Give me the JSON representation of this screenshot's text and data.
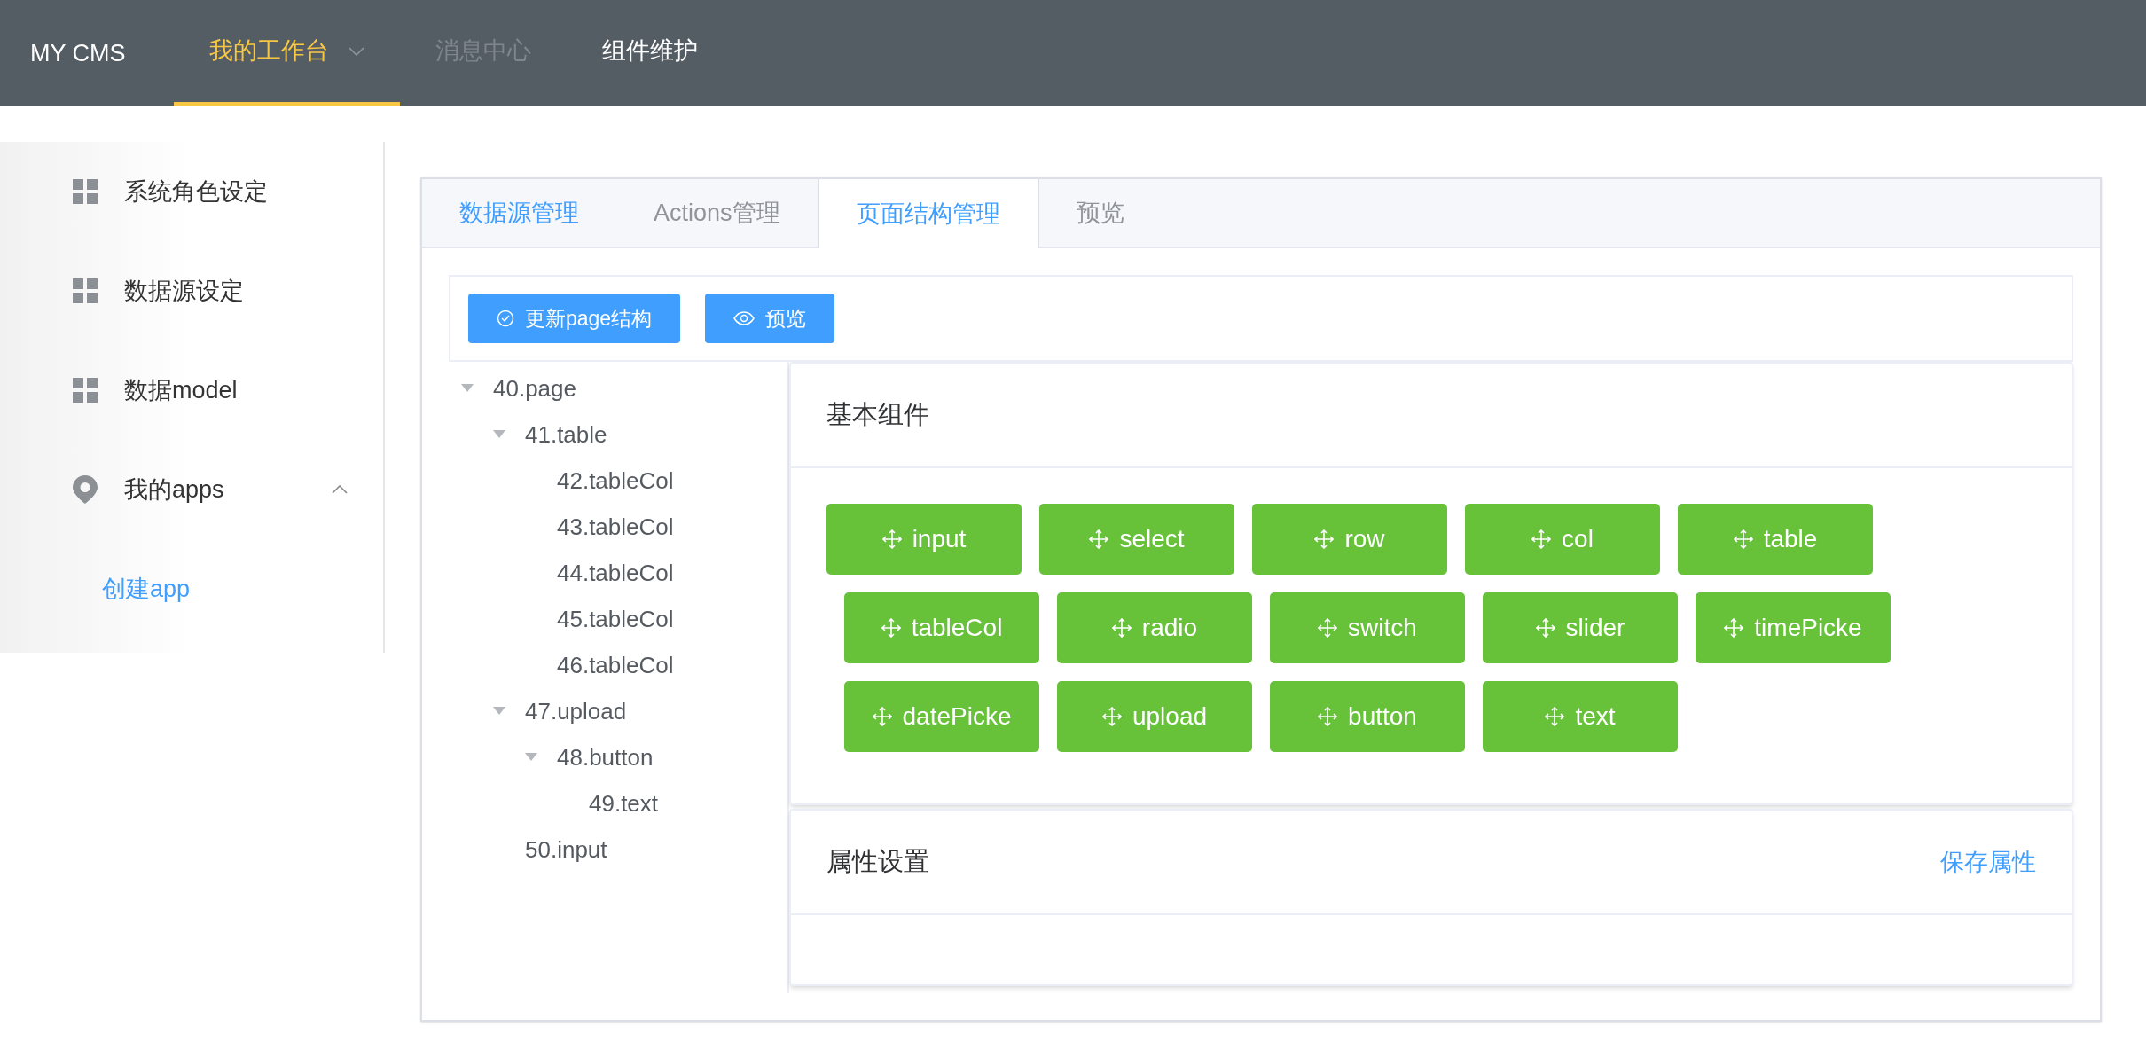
{
  "nav": {
    "brand": "MY CMS",
    "items": [
      {
        "label": "我的工作台",
        "selected": true,
        "disabled": false,
        "dropdown": true
      },
      {
        "label": "消息中心",
        "selected": false,
        "disabled": true,
        "dropdown": false
      },
      {
        "label": "组件维护",
        "selected": false,
        "disabled": false,
        "dropdown": false
      }
    ]
  },
  "sidebar": {
    "items": [
      {
        "kind": "grid",
        "label": "系统角色设定"
      },
      {
        "kind": "grid",
        "label": "数据源设定"
      },
      {
        "kind": "grid",
        "label": "数据model"
      },
      {
        "kind": "location",
        "label": "我的apps",
        "expanded": true,
        "children": [
          {
            "label": "创建app"
          }
        ]
      }
    ]
  },
  "tabs": [
    {
      "label": "数据源管理",
      "selected": false,
      "focused": true
    },
    {
      "label": "Actions管理",
      "selected": false,
      "focused": false
    },
    {
      "label": "页面结构管理",
      "selected": true,
      "focused": false
    },
    {
      "label": "预览",
      "selected": false,
      "focused": false
    }
  ],
  "toolbar": [
    {
      "kind": "check",
      "label": "更新page结构"
    },
    {
      "kind": "eye",
      "label": "预览"
    }
  ],
  "tree": [
    {
      "label": "40.page",
      "expanded": true,
      "children": [
        {
          "label": "41.table",
          "expanded": true,
          "children": [
            {
              "label": "42.tableCol"
            },
            {
              "label": "43.tableCol"
            },
            {
              "label": "44.tableCol"
            },
            {
              "label": "45.tableCol"
            },
            {
              "label": "46.tableCol"
            }
          ]
        },
        {
          "label": "47.upload",
          "expanded": true,
          "children": [
            {
              "label": "48.button",
              "expanded": true,
              "children": [
                {
                  "label": "49.text"
                }
              ]
            }
          ]
        },
        {
          "label": "50.input"
        }
      ]
    }
  ],
  "components_panel": {
    "title": "基本组件",
    "rows": [
      [
        "input",
        "select",
        "row",
        "col",
        "table"
      ],
      [
        "tableCol",
        "radio",
        "switch",
        "slider",
        "timePicke"
      ],
      [
        "datePicke",
        "upload",
        "button",
        "text"
      ]
    ]
  },
  "properties_panel": {
    "title": "属性设置",
    "action": "保存属性"
  }
}
